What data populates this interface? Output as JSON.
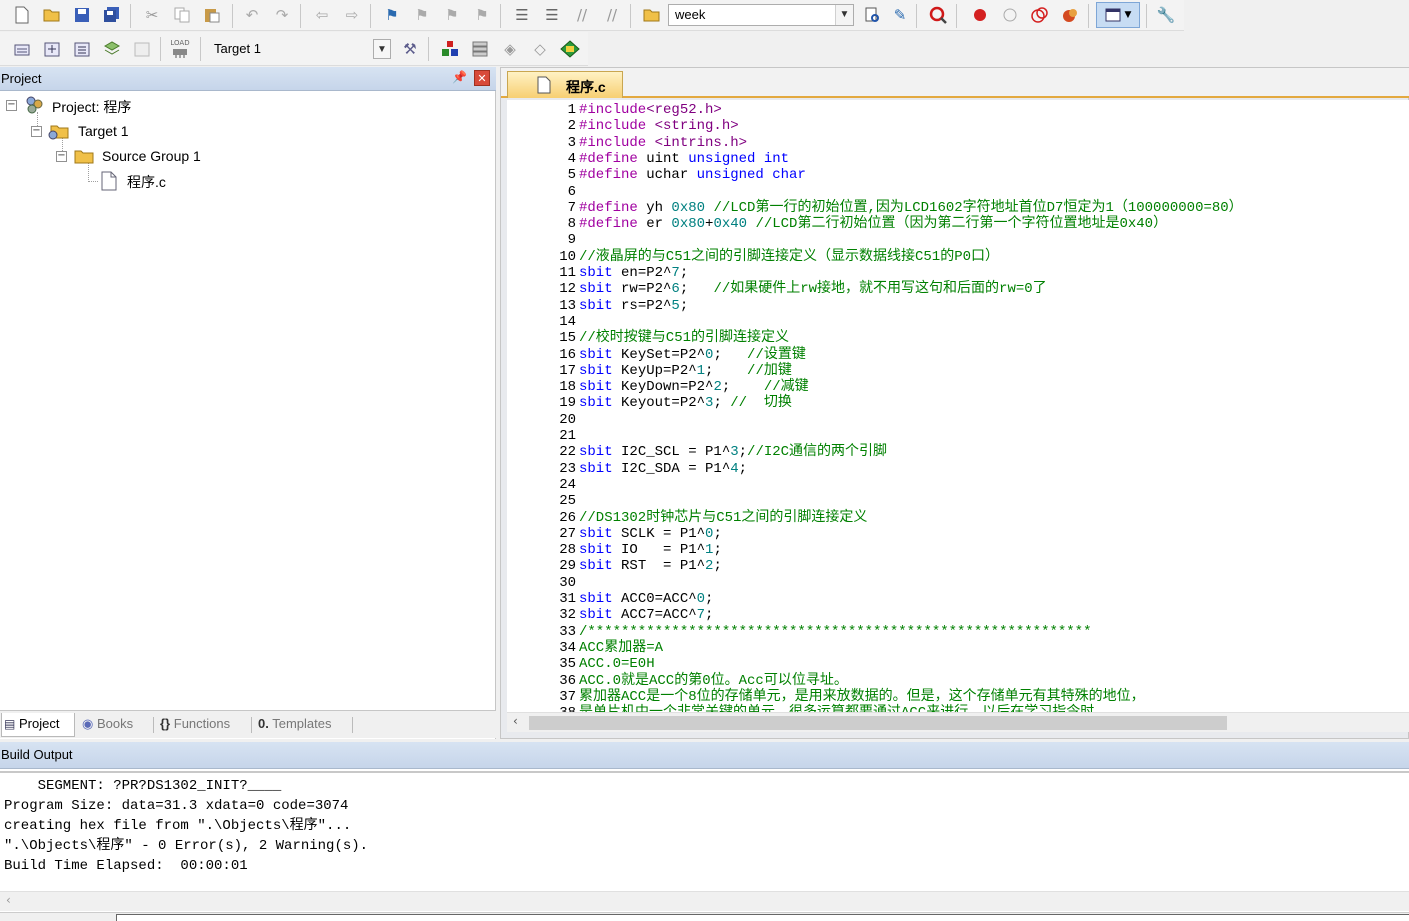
{
  "toolbar1": {
    "find_combo_value": "week"
  },
  "toolbar2": {
    "target_combo_value": "Target 1",
    "load_label": "LOAD"
  },
  "project_panel": {
    "title": "Project",
    "tree": [
      {
        "label": "Project: 程序",
        "icon": "project-icon",
        "level": 0
      },
      {
        "label": "Target 1",
        "icon": "target-icon",
        "level": 1
      },
      {
        "label": "Source Group 1",
        "icon": "folder-icon",
        "level": 2
      },
      {
        "label": "程序.c",
        "icon": "file-icon",
        "level": 3
      }
    ],
    "tabs": [
      {
        "label": "Project",
        "icon": "project-tab-icon",
        "active": true
      },
      {
        "label": "Books",
        "icon": "books-icon",
        "active": false
      },
      {
        "label": "Functions",
        "icon": "functions-icon",
        "active": false
      },
      {
        "label": "Templates",
        "icon": "templates-icon",
        "active": false
      }
    ]
  },
  "editor": {
    "tab_label": "程序.c",
    "lines": [
      "#include<reg52.h>",
      "#include <string.h>",
      "#include <intrins.h>",
      "#define uint unsigned int",
      "#define uchar unsigned char",
      "",
      "#define yh 0x80 //LCD第一行的初始位置,因为LCD1602字符地址首位D7恒定为1（100000000=80）",
      "#define er 0x80+0x40 //LCD第二行初始位置（因为第二行第一个字符位置地址是0x40）",
      "",
      "//液晶屏的与C51之间的引脚连接定义（显示数据线接C51的P0口）",
      "sbit en=P2^7;",
      "sbit rw=P2^6;   //如果硬件上rw接地，就不用写这句和后面的rw=0了",
      "sbit rs=P2^5;",
      "",
      "//校时按键与C51的引脚连接定义",
      "sbit KeySet=P2^0;   //设置键",
      "sbit KeyUp=P2^1;    //加键",
      "sbit KeyDown=P2^2;    //减键",
      "sbit Keyout=P2^3; //  切换",
      "",
      "",
      "sbit I2C_SCL = P1^3;//I2C通信的两个引脚",
      "sbit I2C_SDA = P1^4;",
      "",
      "",
      "//DS1302时钟芯片与C51之间的引脚连接定义",
      "sbit SCLK = P1^0;",
      "sbit IO   = P1^1;",
      "sbit RST  = P1^2;",
      "",
      "sbit ACC0=ACC^0;",
      "sbit ACC7=ACC^7;",
      "/************************************************************",
      "ACC累加器=A",
      "ACC.0=E0H",
      "ACC.0就是ACC的第0位。Acc可以位寻址。",
      "累加器ACC是一个8位的存储单元，是用来放数据的。但是，这个存储单元有其特殊的地位，",
      "是单片机中一个非常关键的单元，很多运算都要通过ACC来进行。以后在学习指令时，"
    ]
  },
  "build_output": {
    "title": "Build Output",
    "lines": [
      "    SEGMENT: ?PR?DS1302_INIT?____",
      "Program Size: data=31.3 xdata=0 code=3074",
      "creating hex file from \".\\Objects\\程序\"...",
      "\".\\Objects\\程序\" - 0 Error(s), 2 Warning(s).",
      "Build Time Elapsed:  00:00:01"
    ]
  },
  "colors": {
    "keyword": "#0000ff",
    "preprocessor": "#a000a0",
    "comment": "#008000",
    "number": "#008080",
    "active_tab": "#f7cf72"
  }
}
